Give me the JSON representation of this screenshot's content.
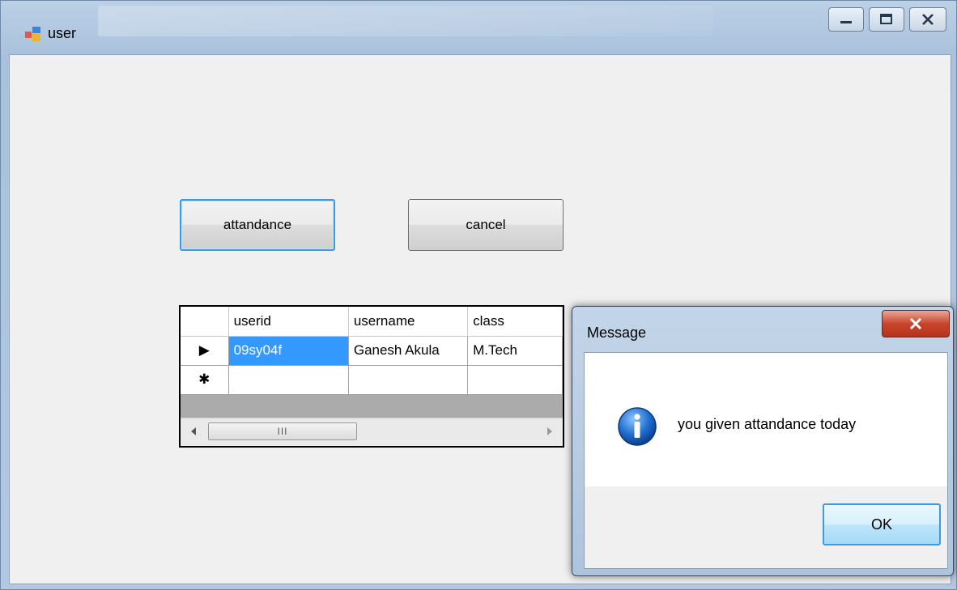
{
  "window": {
    "title": "user"
  },
  "buttons": {
    "attendance_label": "attandance",
    "cancel_label": "cancel"
  },
  "grid": {
    "columns": [
      "userid",
      "username",
      "class"
    ],
    "rows": [
      {
        "marker": "▶",
        "cells": [
          "09sy04f",
          "Ganesh Akula",
          "M.Tech"
        ]
      },
      {
        "marker": "✱",
        "cells": [
          "",
          "",
          ""
        ]
      }
    ],
    "scrollbar_thumb_grip": "III"
  },
  "dialog": {
    "title": "Message",
    "message": "you given attandance today",
    "ok_label": "OK"
  },
  "colors": {
    "selection": "#3399ff",
    "focus_border": "#3c9be1",
    "close_red": "#c8452c"
  }
}
